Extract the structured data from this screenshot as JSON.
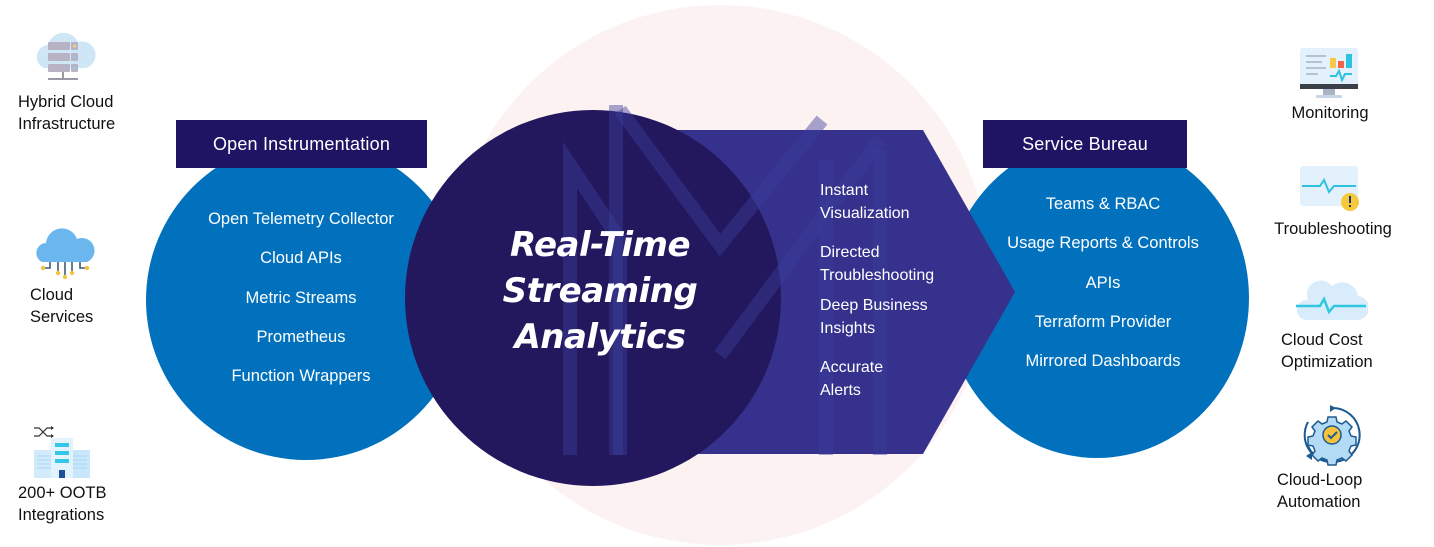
{
  "colors": {
    "background": "#ffffff",
    "watermark_circle": "#fdf2f2",
    "section_circle": "#0171be",
    "center_circle": "#23175e",
    "arrow": "#36318c",
    "header_box": "#1f1464",
    "text_light": "#ffffff",
    "text_dark": "#111111"
  },
  "left_column": {
    "items": [
      {
        "icon": "server-cloud-icon",
        "label_line1": "Hybrid Cloud",
        "label_line2": "Infrastructure"
      },
      {
        "icon": "cloud-network-icon",
        "label_line1": "Cloud",
        "label_line2": "Services"
      },
      {
        "icon": "building-integrations-icon",
        "label_line1": "200+ OOTB",
        "label_line2": "Integrations"
      }
    ]
  },
  "open_instrumentation": {
    "title": "Open Instrumentation",
    "items": [
      "Open Telemetry Collector",
      "Cloud APIs",
      "Metric Streams",
      "Prometheus",
      "Function Wrappers"
    ]
  },
  "center": {
    "title_line1": "Real-Time",
    "title_line2": "Streaming",
    "title_line3": "Analytics"
  },
  "features": {
    "items": [
      {
        "line1": "Instant",
        "line2": "Visualization"
      },
      {
        "line1": "Directed",
        "line2": "Troubleshooting"
      },
      {
        "line1": "Deep Business",
        "line2": "Insights"
      },
      {
        "line1": "Accurate",
        "line2": "Alerts"
      }
    ]
  },
  "service_bureau": {
    "title": "Service Bureau",
    "items": [
      "Teams & RBAC",
      "Usage Reports & Controls",
      "APIs",
      "Terraform Provider",
      "Mirrored Dashboards"
    ]
  },
  "right_column": {
    "items": [
      {
        "icon": "monitor-dashboard-icon",
        "label_line1": "Monitoring",
        "label_line2": ""
      },
      {
        "icon": "heartbeat-alert-icon",
        "label_line1": "Troubleshooting",
        "label_line2": ""
      },
      {
        "icon": "cloud-pulse-icon",
        "label_line1": "Cloud Cost",
        "label_line2": "Optimization"
      },
      {
        "icon": "gear-cycle-icon",
        "label_line1": "Cloud-Loop",
        "label_line2": "Automation"
      }
    ]
  }
}
